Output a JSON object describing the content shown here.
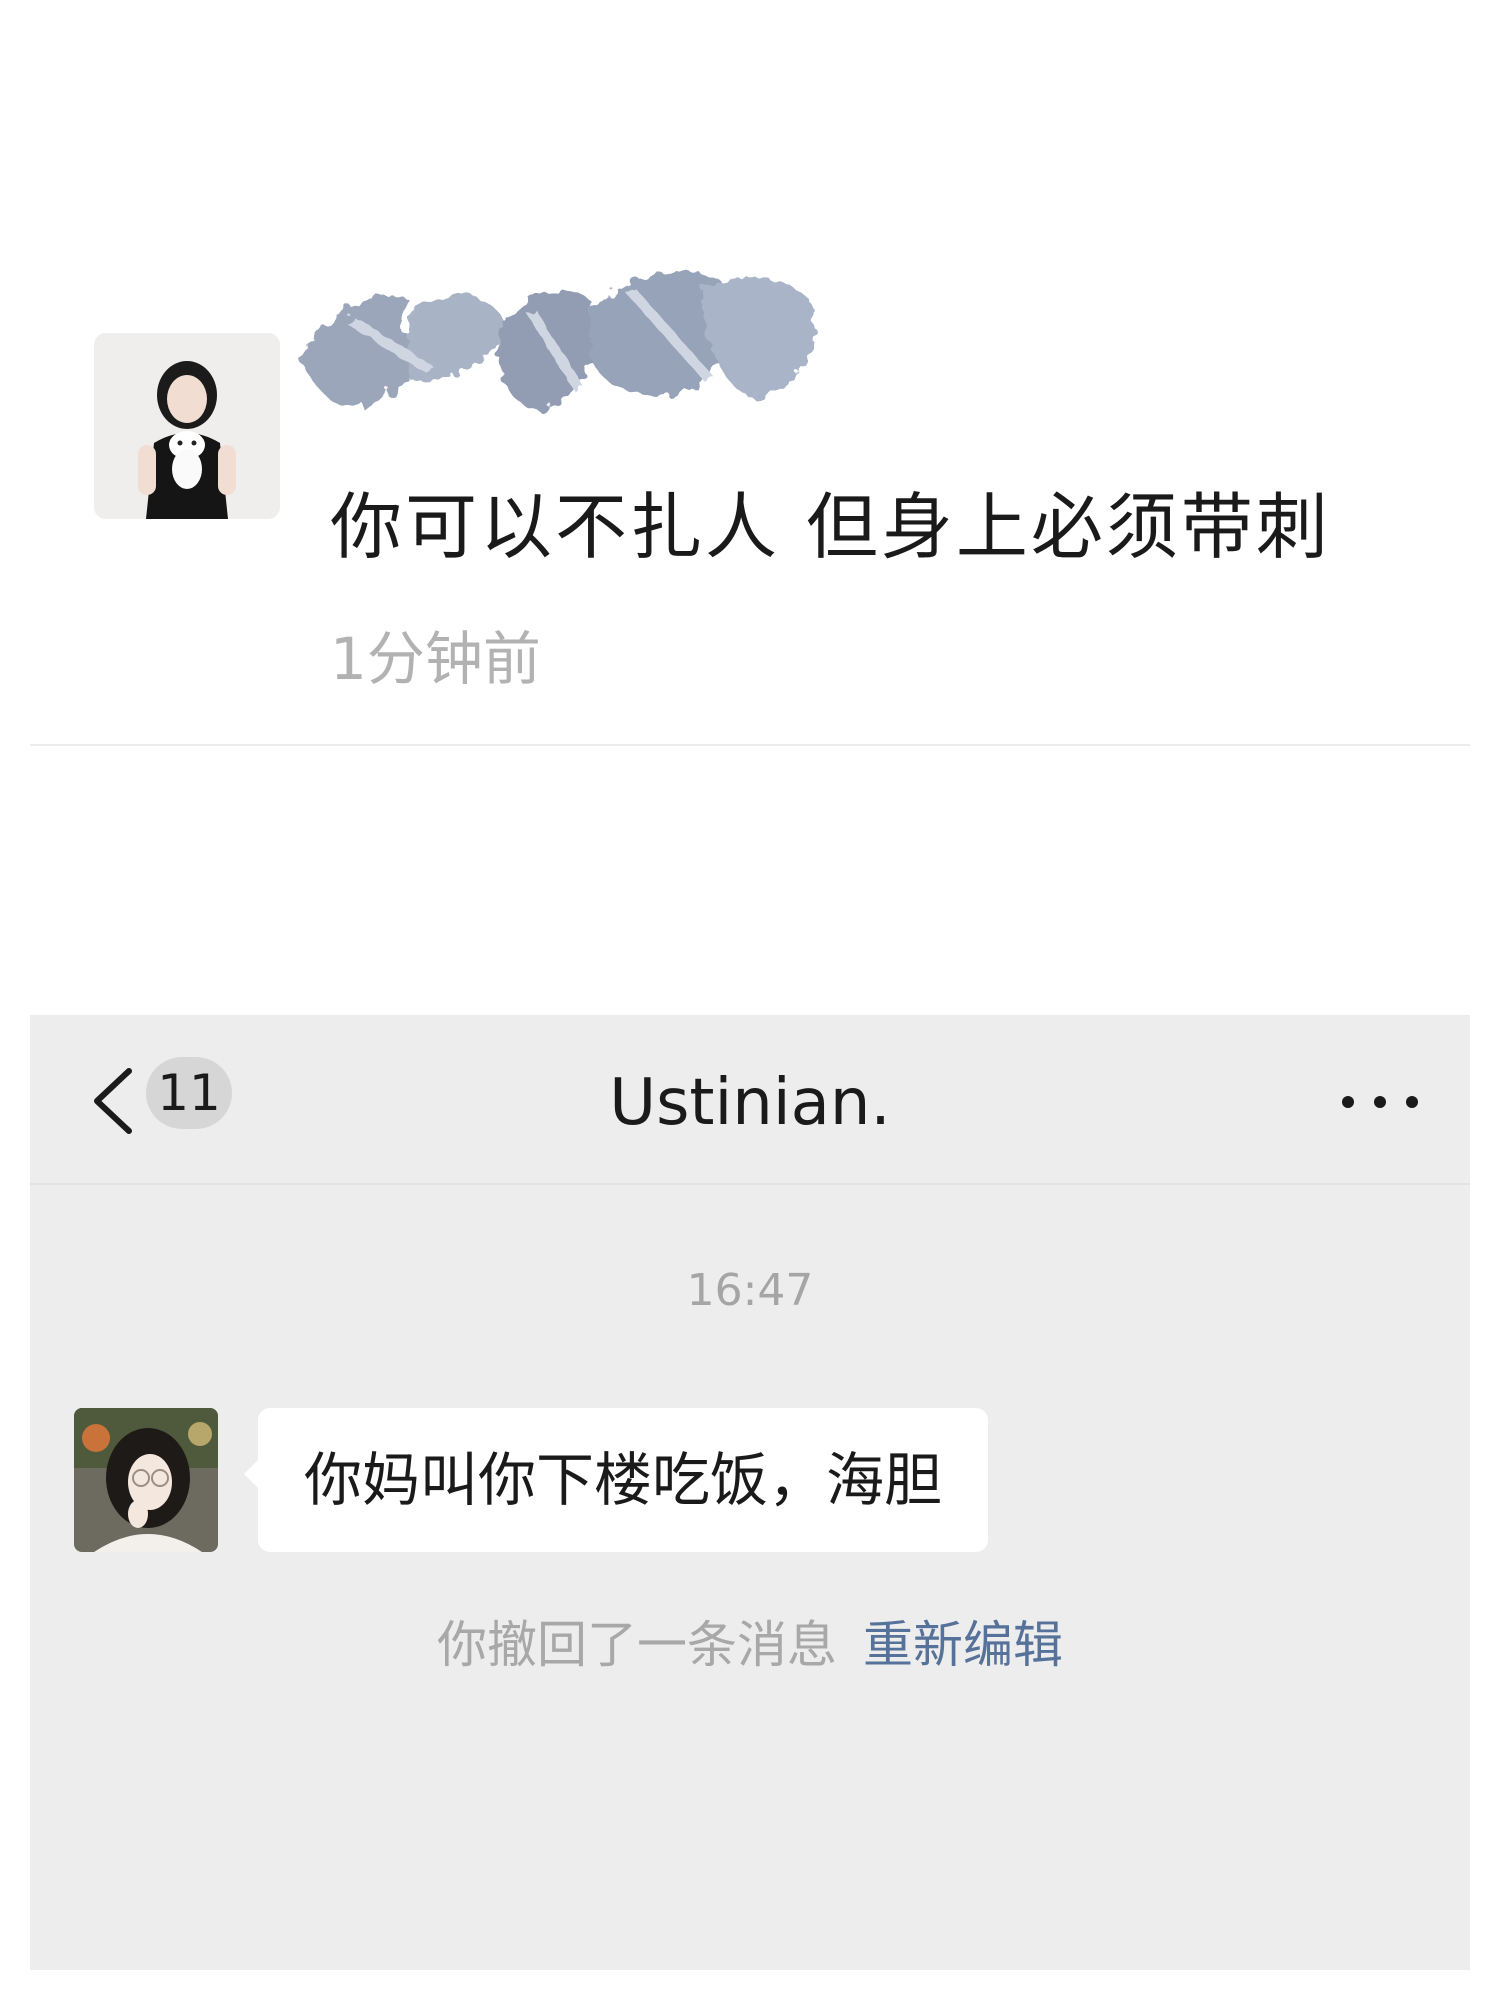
{
  "post": {
    "text": "你可以不扎人 但身上必须带刺",
    "time": "1分钟前"
  },
  "chat": {
    "unread_count": "11",
    "title": "Ustinian.",
    "timestamp": "16:47",
    "message": "你妈叫你下楼吃饭，海胆",
    "recall_notice": "你撤回了一条消息",
    "reedit_label": "重新编辑"
  },
  "colors": {
    "chat_background": "#ededed",
    "link_blue": "#57729a",
    "secondary_text": "#b2b2b2"
  },
  "icons": [
    "back-chevron-icon",
    "more-dots-icon"
  ]
}
